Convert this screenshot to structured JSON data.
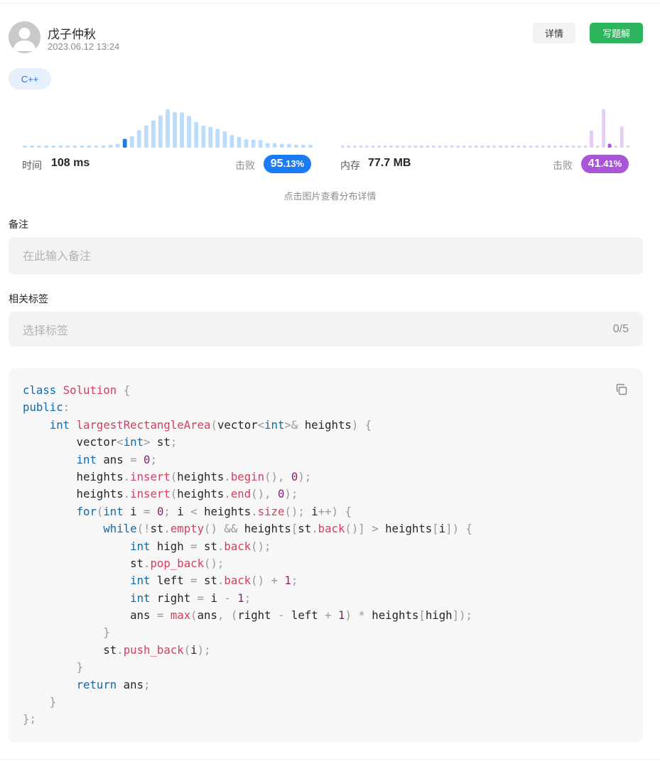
{
  "author": {
    "name": "戊子仲秋",
    "timestamp": "2023.06.12 13:24",
    "avatar_icon": "default-user-avatar"
  },
  "actions": {
    "detail_label": "详情",
    "solution_label": "写题解",
    "solution_color": "#2db55d"
  },
  "language_tag": "C++",
  "runtime": {
    "label": "时间",
    "value": "108 ms",
    "beats_label": "击败",
    "beats_int": "95",
    "beats_dec": ".13%",
    "color": "#1a7cf4",
    "bar_color": "#bcdcfb",
    "distribution": [
      0,
      0,
      0,
      0,
      0,
      0,
      0,
      0,
      0,
      0,
      0,
      0,
      0.04,
      0.1,
      0.23,
      0.3,
      0.46,
      0.58,
      0.71,
      0.84,
      1.0,
      0.93,
      0.92,
      0.83,
      0.67,
      0.57,
      0.54,
      0.49,
      0.43,
      0.33,
      0.28,
      0.22,
      0.21,
      0.2,
      0.12,
      0.12,
      0.1,
      0.1,
      0.07,
      0.06,
      0.05
    ],
    "highlight_index": 14
  },
  "memory": {
    "label": "内存",
    "value": "77.7 MB",
    "beats_label": "击败",
    "beats_int": "41",
    "beats_dec": ".41%",
    "color": "#a855d8",
    "bar_color": "#e6cdf5",
    "distribution": [
      0,
      0,
      0,
      0,
      0,
      0,
      0,
      0,
      0,
      0,
      0,
      0,
      0,
      0,
      0,
      0,
      0,
      0,
      0,
      0,
      0,
      0,
      0,
      0,
      0,
      0,
      0,
      0,
      0,
      0,
      0,
      0,
      0,
      0,
      0,
      0,
      0,
      0,
      0,
      0,
      0,
      0.45,
      0,
      1.0,
      0.1,
      0,
      0.55,
      0
    ],
    "highlight_index": 44
  },
  "distribution_hint": "点击图片查看分布详情",
  "note": {
    "label": "备注",
    "placeholder": "在此输入备注"
  },
  "tags": {
    "label": "相关标签",
    "placeholder": "选择标签",
    "count": "0/5"
  },
  "code": {
    "copy_icon": "copy-icon",
    "lines": [
      [
        [
          "kw",
          "class"
        ],
        [
          "t",
          " "
        ],
        [
          "fn",
          "Solution"
        ],
        [
          "t",
          " "
        ],
        [
          "pn",
          "{"
        ]
      ],
      [
        [
          "kw",
          "public"
        ],
        [
          "pn",
          ":"
        ]
      ],
      [
        [
          "t",
          "    "
        ],
        [
          "kw",
          "int"
        ],
        [
          "t",
          " "
        ],
        [
          "fn",
          "largestRectangleArea"
        ],
        [
          "pn",
          "("
        ],
        [
          "t",
          "vector"
        ],
        [
          "pn",
          "<"
        ],
        [
          "kw",
          "int"
        ],
        [
          "pn",
          ">&"
        ],
        [
          "t",
          " heights"
        ],
        [
          "pn",
          ")"
        ],
        [
          "t",
          " "
        ],
        [
          "pn",
          "{"
        ]
      ],
      [
        [
          "t",
          "        vector"
        ],
        [
          "pn",
          "<"
        ],
        [
          "kw",
          "int"
        ],
        [
          "pn",
          ">"
        ],
        [
          "t",
          " st"
        ],
        [
          "pn",
          ";"
        ]
      ],
      [
        [
          "t",
          "        "
        ],
        [
          "kw",
          "int"
        ],
        [
          "t",
          " ans "
        ],
        [
          "pn",
          "="
        ],
        [
          "t",
          " "
        ],
        [
          "num",
          "0"
        ],
        [
          "pn",
          ";"
        ]
      ],
      [
        [
          "t",
          "        heights"
        ],
        [
          "pn",
          "."
        ],
        [
          "fn",
          "insert"
        ],
        [
          "pn",
          "("
        ],
        [
          "t",
          "heights"
        ],
        [
          "pn",
          "."
        ],
        [
          "fn",
          "begin"
        ],
        [
          "pn",
          "(),"
        ],
        [
          "t",
          " "
        ],
        [
          "num",
          "0"
        ],
        [
          "pn",
          ");"
        ]
      ],
      [
        [
          "t",
          "        heights"
        ],
        [
          "pn",
          "."
        ],
        [
          "fn",
          "insert"
        ],
        [
          "pn",
          "("
        ],
        [
          "t",
          "heights"
        ],
        [
          "pn",
          "."
        ],
        [
          "fn",
          "end"
        ],
        [
          "pn",
          "(),"
        ],
        [
          "t",
          " "
        ],
        [
          "num",
          "0"
        ],
        [
          "pn",
          ");"
        ]
      ],
      [
        [
          "t",
          "        "
        ],
        [
          "kw",
          "for"
        ],
        [
          "pn",
          "("
        ],
        [
          "kw",
          "int"
        ],
        [
          "t",
          " i "
        ],
        [
          "pn",
          "="
        ],
        [
          "t",
          " "
        ],
        [
          "num",
          "0"
        ],
        [
          "pn",
          ";"
        ],
        [
          "t",
          " i "
        ],
        [
          "pn",
          "<"
        ],
        [
          "t",
          " heights"
        ],
        [
          "pn",
          "."
        ],
        [
          "fn",
          "size"
        ],
        [
          "pn",
          "();"
        ],
        [
          "t",
          " i"
        ],
        [
          "pn",
          "++)"
        ],
        [
          "t",
          " "
        ],
        [
          "pn",
          "{"
        ]
      ],
      [
        [
          "t",
          "            "
        ],
        [
          "kw",
          "while"
        ],
        [
          "pn",
          "(!"
        ],
        [
          "t",
          "st"
        ],
        [
          "pn",
          "."
        ],
        [
          "fn",
          "empty"
        ],
        [
          "pn",
          "()"
        ],
        [
          "t",
          " "
        ],
        [
          "pn",
          "&&"
        ],
        [
          "t",
          " heights"
        ],
        [
          "pn",
          "["
        ],
        [
          "t",
          "st"
        ],
        [
          "pn",
          "."
        ],
        [
          "fn",
          "back"
        ],
        [
          "pn",
          "()]"
        ],
        [
          "t",
          " "
        ],
        [
          "pn",
          ">"
        ],
        [
          "t",
          " heights"
        ],
        [
          "pn",
          "["
        ],
        [
          "t",
          "i"
        ],
        [
          "pn",
          "])"
        ],
        [
          "t",
          " "
        ],
        [
          "pn",
          "{"
        ]
      ],
      [
        [
          "t",
          "                "
        ],
        [
          "kw",
          "int"
        ],
        [
          "t",
          " high "
        ],
        [
          "pn",
          "="
        ],
        [
          "t",
          " st"
        ],
        [
          "pn",
          "."
        ],
        [
          "fn",
          "back"
        ],
        [
          "pn",
          "();"
        ]
      ],
      [
        [
          "t",
          "                st"
        ],
        [
          "pn",
          "."
        ],
        [
          "fn",
          "pop_back"
        ],
        [
          "pn",
          "();"
        ]
      ],
      [
        [
          "t",
          "                "
        ],
        [
          "kw",
          "int"
        ],
        [
          "t",
          " left "
        ],
        [
          "pn",
          "="
        ],
        [
          "t",
          " st"
        ],
        [
          "pn",
          "."
        ],
        [
          "fn",
          "back"
        ],
        [
          "pn",
          "()"
        ],
        [
          "t",
          " "
        ],
        [
          "pn",
          "+"
        ],
        [
          "t",
          " "
        ],
        [
          "num",
          "1"
        ],
        [
          "pn",
          ";"
        ]
      ],
      [
        [
          "t",
          "                "
        ],
        [
          "kw",
          "int"
        ],
        [
          "t",
          " right "
        ],
        [
          "pn",
          "="
        ],
        [
          "t",
          " i "
        ],
        [
          "pn",
          "-"
        ],
        [
          "t",
          " "
        ],
        [
          "num",
          "1"
        ],
        [
          "pn",
          ";"
        ]
      ],
      [
        [
          "t",
          "                ans "
        ],
        [
          "pn",
          "="
        ],
        [
          "t",
          " "
        ],
        [
          "fn",
          "max"
        ],
        [
          "pn",
          "("
        ],
        [
          "t",
          "ans"
        ],
        [
          "pn",
          ","
        ],
        [
          "t",
          " "
        ],
        [
          "pn",
          "("
        ],
        [
          "t",
          "right "
        ],
        [
          "pn",
          "-"
        ],
        [
          "t",
          " left "
        ],
        [
          "pn",
          "+"
        ],
        [
          "t",
          " "
        ],
        [
          "num",
          "1"
        ],
        [
          "pn",
          ")"
        ],
        [
          "t",
          " "
        ],
        [
          "pn",
          "*"
        ],
        [
          "t",
          " heights"
        ],
        [
          "pn",
          "["
        ],
        [
          "t",
          "high"
        ],
        [
          "pn",
          "]);"
        ]
      ],
      [
        [
          "t",
          "            "
        ],
        [
          "pn",
          "}"
        ]
      ],
      [
        [
          "t",
          "            st"
        ],
        [
          "pn",
          "."
        ],
        [
          "fn",
          "push_back"
        ],
        [
          "pn",
          "("
        ],
        [
          "t",
          "i"
        ],
        [
          "pn",
          ");"
        ]
      ],
      [
        [
          "t",
          "        "
        ],
        [
          "pn",
          "}"
        ]
      ],
      [
        [
          "t",
          "        "
        ],
        [
          "kw",
          "return"
        ],
        [
          "t",
          " ans"
        ],
        [
          "pn",
          ";"
        ]
      ],
      [
        [
          "t",
          "    "
        ],
        [
          "pn",
          "}"
        ]
      ],
      [
        [
          "pn",
          "};"
        ]
      ]
    ]
  }
}
